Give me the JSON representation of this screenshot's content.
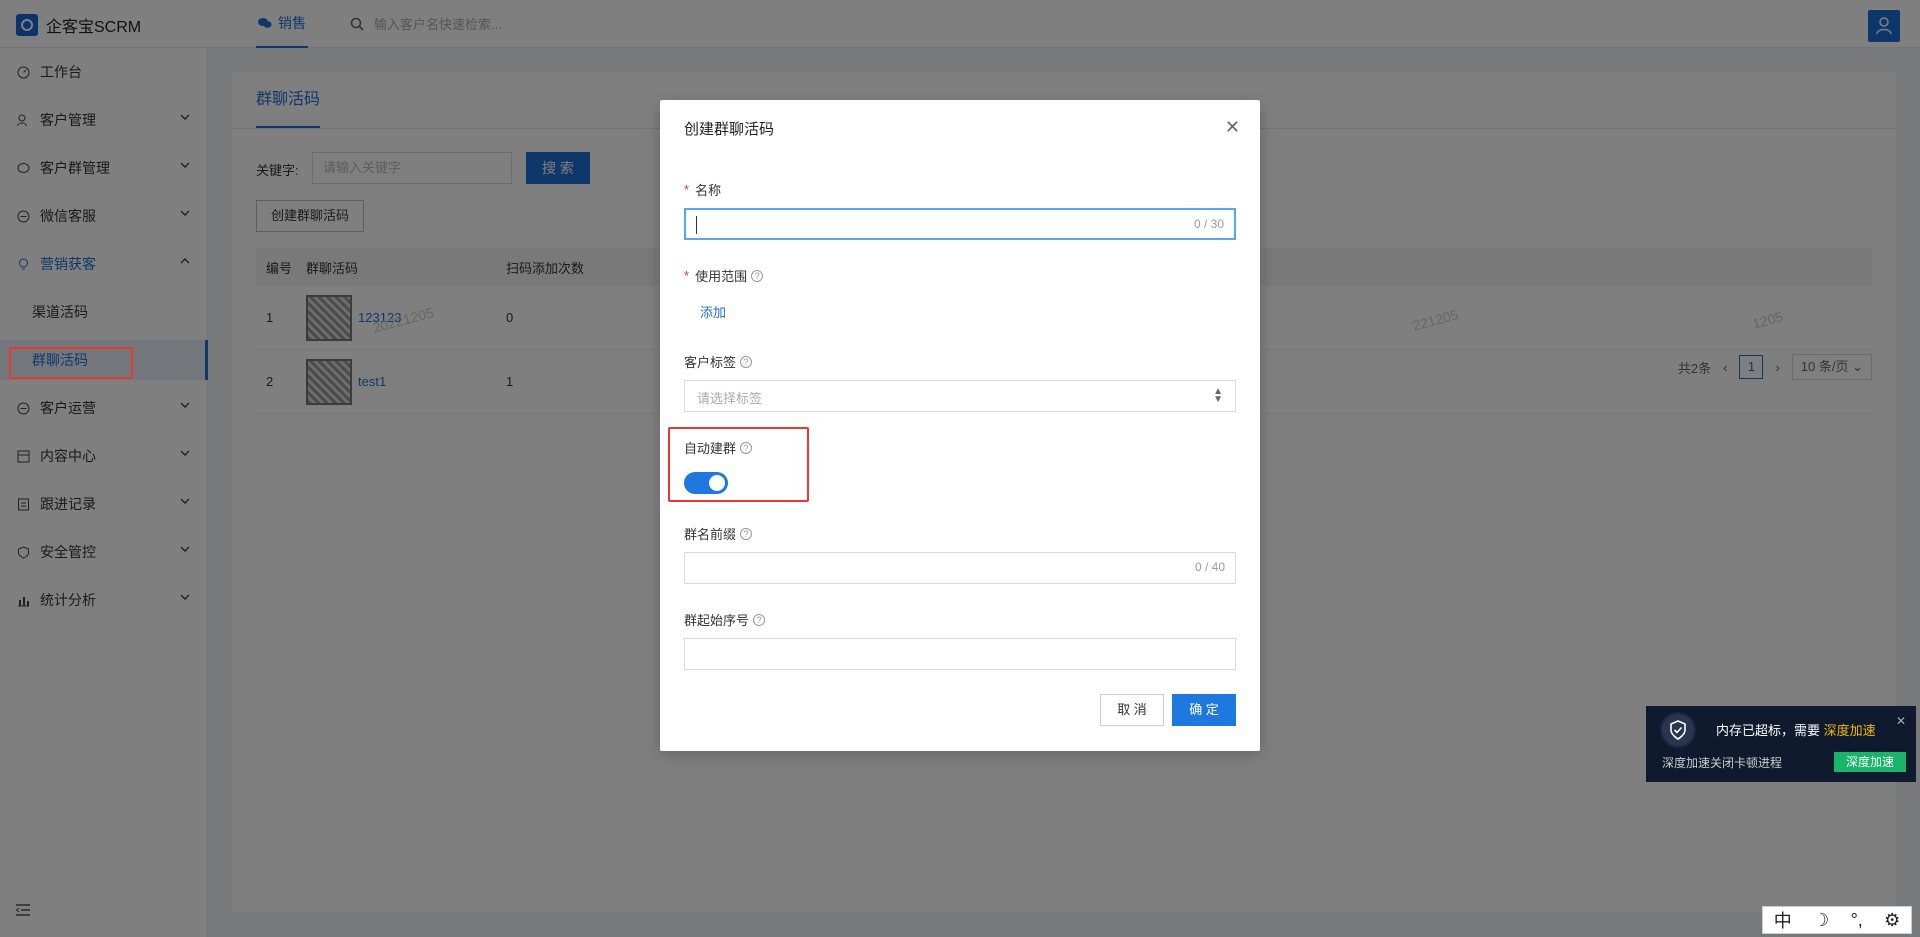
{
  "app": {
    "title": "企客宝SCRM"
  },
  "topbar": {
    "tab": "销售",
    "search_placeholder": "输入客户名快速检索..."
  },
  "sidebar": {
    "items": [
      {
        "label": "工作台"
      },
      {
        "label": "客户管理"
      },
      {
        "label": "客户群管理"
      },
      {
        "label": "微信客服"
      },
      {
        "label": "营销获客"
      },
      {
        "label": "渠道活码"
      },
      {
        "label": "群聊活码"
      },
      {
        "label": "客户运营"
      },
      {
        "label": "内容中心"
      },
      {
        "label": "跟进记录"
      },
      {
        "label": "安全管控"
      },
      {
        "label": "统计分析"
      }
    ]
  },
  "page": {
    "title": "群聊活码",
    "keyword_label": "关键字:",
    "keyword_placeholder": "请输入关键字",
    "search_button": "搜 索",
    "create_button": "创建群聊活码",
    "table": {
      "headers": [
        "编号",
        "群聊活码",
        "扫码添加次数"
      ],
      "rows": [
        {
          "no": "1",
          "name": "123123",
          "count": "0"
        },
        {
          "no": "2",
          "name": "test1",
          "count": "1"
        }
      ]
    },
    "watermarks": [
      "20221205",
      "221205",
      "1205"
    ],
    "pager": {
      "total": "共2条",
      "page": "1",
      "size": "10 条/页"
    }
  },
  "modal": {
    "title": "创建群聊活码",
    "name_label": "名称",
    "name_count": "0 / 30",
    "scope_label": "使用范围",
    "add_link": "添加",
    "tag_label": "客户标签",
    "tag_placeholder": "请选择标签",
    "auto_label": "自动建群",
    "auto_enabled": true,
    "prefix_label": "群名前缀",
    "prefix_count": "0 / 40",
    "start_label": "群起始序号",
    "cancel": "取 消",
    "ok": "确 定"
  },
  "notification": {
    "text": "内存已超标，需要",
    "highlight": "深度加速",
    "sub": "深度加速关闭卡顿进程",
    "button": "深度加速"
  },
  "ime": {
    "mode": "中"
  }
}
